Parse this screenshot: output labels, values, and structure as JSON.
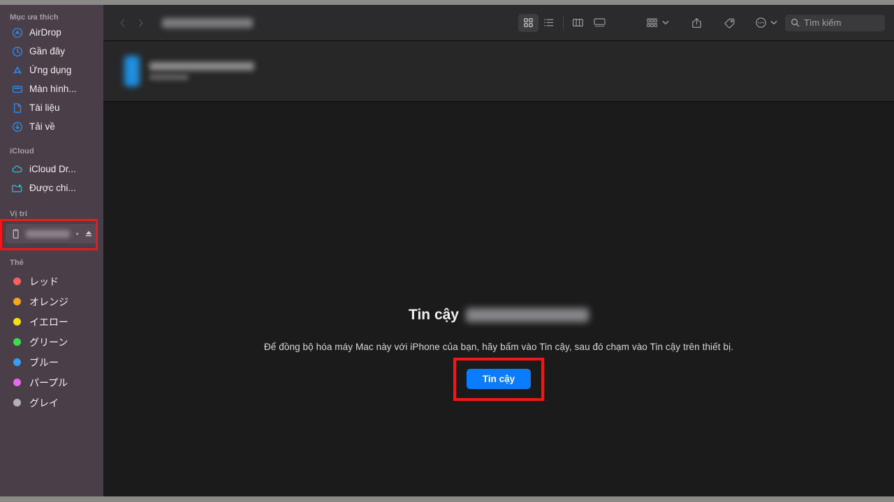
{
  "window": {
    "title_redacted": true,
    "platform": "macOS Finder"
  },
  "toolbar": {
    "view_modes": [
      {
        "name": "icon-view",
        "label": "Dạng biểu tượng",
        "selected": true
      },
      {
        "name": "list-view",
        "label": "Dạng danh sách",
        "selected": false
      },
      {
        "name": "column-view",
        "label": "Dạng cột",
        "selected": false
      },
      {
        "name": "gallery-view",
        "label": "Dạng bộ sưu tập",
        "selected": false
      }
    ],
    "group_by_label": "Nhóm",
    "share_label": "Chia sẻ",
    "tag_label": "Thẻ",
    "more_label": "Thao tác khác",
    "back_label": "Quay lại",
    "forward_label": "Tiếp theo"
  },
  "search": {
    "placeholder": "Tìm kiếm",
    "value": ""
  },
  "sidebar": {
    "sections": [
      {
        "title": "Mục ưa thích",
        "items": [
          {
            "label": "AirDrop",
            "icon": "airdrop-icon",
            "color": "#2f8ef4"
          },
          {
            "label": "Gần đây",
            "icon": "clock-icon",
            "color": "#2f8ef4"
          },
          {
            "label": "Ứng dụng",
            "icon": "appstore-icon",
            "color": "#2f8ef4"
          },
          {
            "label": "Màn hình...",
            "icon": "desktop-icon",
            "color": "#2f8ef4"
          },
          {
            "label": "Tài liệu",
            "icon": "document-icon",
            "color": "#2f8ef4"
          },
          {
            "label": "Tải về",
            "icon": "download-icon",
            "color": "#2f8ef4"
          }
        ]
      },
      {
        "title": "iCloud",
        "items": [
          {
            "label": "iCloud Dr...",
            "icon": "cloud-icon",
            "color": "#3ab8d8"
          },
          {
            "label": "Được chi...",
            "icon": "shared-folder-icon",
            "color": "#3ab8d8"
          }
        ]
      },
      {
        "title": "Vị trí",
        "items": [
          {
            "label": "",
            "icon": "iphone-icon",
            "redacted": true,
            "eject": true,
            "highlighted": true
          }
        ]
      },
      {
        "title": "Thẻ",
        "items": [
          {
            "label": "レッド",
            "icon": "tag-dot",
            "color": "#fc605c"
          },
          {
            "label": "オレンジ",
            "icon": "tag-dot",
            "color": "#f5a623"
          },
          {
            "label": "イエロー",
            "icon": "tag-dot",
            "color": "#f6dd1c"
          },
          {
            "label": "グリーン",
            "icon": "tag-dot",
            "color": "#3ddc4a"
          },
          {
            "label": "ブルー",
            "icon": "tag-dot",
            "color": "#3b9dfb"
          },
          {
            "label": "パープル",
            "icon": "tag-dot",
            "color": "#e46bf0"
          },
          {
            "label": "グレイ",
            "icon": "tag-dot",
            "color": "#b3b0b5"
          }
        ]
      }
    ]
  },
  "file_strip": {
    "item_redacted": true,
    "icon": "iphone-device-icon"
  },
  "main": {
    "trust_title_prefix": "Tin cậy",
    "device_name_redacted": true,
    "description": "Để đồng bộ hóa máy Mac này với iPhone của bạn, hãy bấm vào Tin cậy, sau đó chạm vào Tin cậy trên thiết bị.",
    "trust_button_label": "Tin cậy"
  },
  "annotations": {
    "highlight_color": "#f61616",
    "accent_button_color": "#0a7cff"
  }
}
